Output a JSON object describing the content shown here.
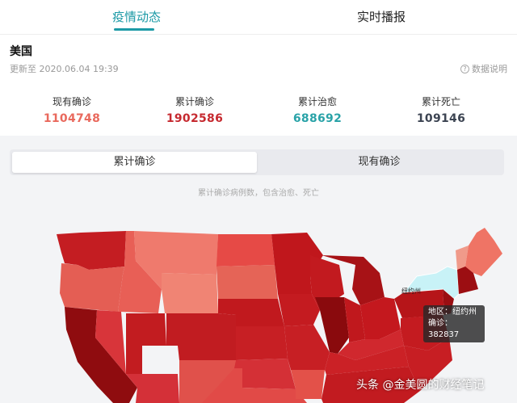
{
  "tabs": [
    {
      "label": "疫情动态",
      "active": true
    },
    {
      "label": "实时播报",
      "active": false
    }
  ],
  "header": {
    "country": "美国",
    "updated": "更新至 2020.06.04 19:39",
    "help_label": "数据说明",
    "help_icon": "question-circle-icon"
  },
  "stats": [
    {
      "label": "现有确诊",
      "value": "1104748",
      "color": "#e9695d"
    },
    {
      "label": "累计确诊",
      "value": "1902586",
      "color": "#c62a30"
    },
    {
      "label": "累计治愈",
      "value": "688692",
      "color": "#2aa3a8"
    },
    {
      "label": "累计死亡",
      "value": "109146",
      "color": "#3c4452"
    }
  ],
  "segment": {
    "options": [
      "累计确诊",
      "现有确诊"
    ],
    "selected": "累计确诊"
  },
  "map": {
    "note": "累计确诊病例数，包含治愈、死亡",
    "highlight_label": "纽约州",
    "tooltip": {
      "region": "地区：纽约州",
      "confirmed": "确诊：382837"
    }
  },
  "watermark": "头条 @金美圆的财经笔记"
}
